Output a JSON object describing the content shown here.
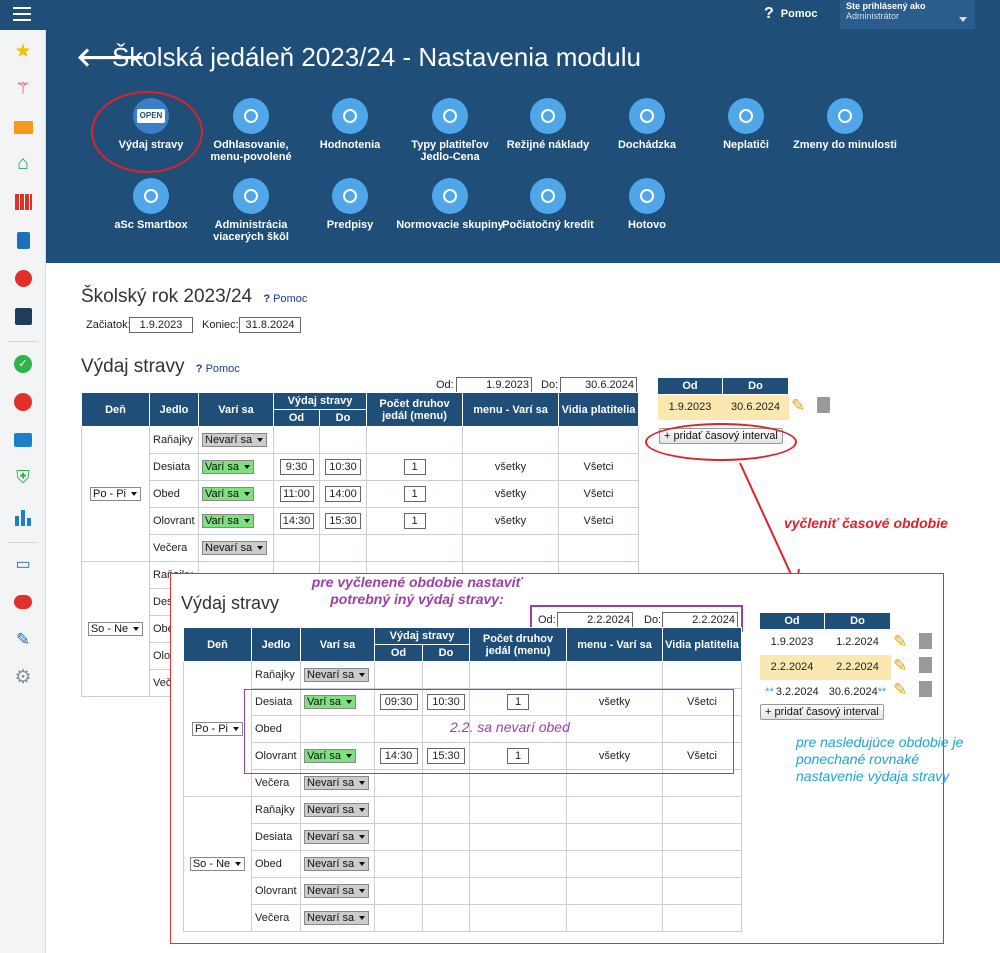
{
  "topbar": {
    "help_label": "Pomoc",
    "logged_as_label": "Ste prihlásený ako",
    "role_value": "Administrátor"
  },
  "header": {
    "title": "Školská jedáleň 2023/24 - Nastavenia modulu"
  },
  "tiles": [
    {
      "label": "Výdaj stravy",
      "icon": "open-sign-icon"
    },
    {
      "label": "Odhlasovanie, menu-povolené",
      "icon": "clock-icon"
    },
    {
      "label": "Hodnotenia",
      "icon": "star-icon"
    },
    {
      "label": "Typy platiteľov Jedlo-Cena",
      "icon": "payer-icon"
    },
    {
      "label": "Režijné náklady",
      "icon": "euro-plus-icon"
    },
    {
      "label": "Dochádzka",
      "icon": "walking-icon"
    },
    {
      "label": "Neplatiči",
      "icon": "money-bag-icon"
    },
    {
      "label": "Zmeny do minulosti",
      "icon": "alarm-icon"
    },
    {
      "label": "aSc Smartbox",
      "icon": "monitor-icon"
    },
    {
      "label": "Administrácia viacerých škôl",
      "icon": "hierarchy-icon"
    },
    {
      "label": "Predpisy",
      "icon": "handshake-icon"
    },
    {
      "label": "Normovacie skupiny",
      "icon": "groups-icon"
    },
    {
      "label": "Počiatočný kredit",
      "icon": "euro-arrow-icon"
    },
    {
      "label": "Hotovo",
      "icon": "check-icon"
    }
  ],
  "school_year": {
    "title": "Školský rok 2023/24",
    "help": "Pomoc",
    "start_label": "Začiatok:",
    "start_value": "1.9.2023",
    "end_label": "Koniec:",
    "end_value": "31.8.2024"
  },
  "section": {
    "title": "Výdaj stravy",
    "help": "Pomoc",
    "od_label": "Od:",
    "od_value": "1.9.2023",
    "do_label": "Do:",
    "do_value": "30.6.2024"
  },
  "columns": {
    "den": "Deň",
    "jedlo": "Jedlo",
    "vari_sa": "Varí sa",
    "vydaj": "Výdaj stravy",
    "od": "Od",
    "do": "Do",
    "pocet": "Počet druhov jedál (menu)",
    "menu": "menu - Varí sa",
    "vidia": "Vidia platitelia"
  },
  "main_rows": [
    {
      "meal": "Raňajky",
      "status": "Nevarí sa",
      "od": "",
      "do": "",
      "count": "",
      "menu": "",
      "payers": ""
    },
    {
      "meal": "Desiata",
      "status": "Varí sa",
      "od": "9:30",
      "do": "10:30",
      "count": "1",
      "menu": "všetky",
      "payers": "Všetci"
    },
    {
      "meal": "Obed",
      "status": "Varí sa",
      "od": "11:00",
      "do": "14:00",
      "count": "1",
      "menu": "všetky",
      "payers": "Všetci"
    },
    {
      "meal": "Olovrant",
      "status": "Varí sa",
      "od": "14:30",
      "do": "15:30",
      "count": "1",
      "menu": "všetky",
      "payers": "Všetci"
    },
    {
      "meal": "Večera",
      "status": "Nevarí sa",
      "od": "",
      "do": "",
      "count": "",
      "menu": "",
      "payers": ""
    }
  ],
  "main_days": {
    "weekday": "Po - Pi",
    "weekend": "So - Ne",
    "weekend_meals": [
      "Raňajky",
      "Desiata",
      "Obed",
      "Olovrant",
      "Večera"
    ]
  },
  "intervals": {
    "od_header": "Od",
    "do_header": "Do",
    "rows": [
      {
        "od": "1.9.2023",
        "do": "30.6.2024"
      }
    ],
    "add_button": "+ pridať časový interval"
  },
  "annotations": {
    "split_label": "vyčleniť časové obdobie",
    "set_label": "pre vyčlenené obdobie nastaviť potrebný iný výdaj stravy:",
    "no_lunch": "2.2. sa nevarí obed",
    "remaining": "pre nasledujúce obdobie je ponechané rovnaké nastavenie výdaja stravy"
  },
  "inset": {
    "title": "Výdaj stravy",
    "od_label": "Od:",
    "od_value": "2.2.2024",
    "do_label": "Do:",
    "do_value": "2.2.2024",
    "weekday_label": "Po - Pi",
    "weekend_label": "So - Ne",
    "rows": [
      {
        "meal": "Raňajky",
        "status": "Nevarí sa",
        "od": "",
        "do": "",
        "count": "",
        "menu": "",
        "payers": ""
      },
      {
        "meal": "Desiata",
        "status": "Varí sa",
        "od": "09:30",
        "do": "10:30",
        "count": "1",
        "menu": "všetky",
        "payers": "Všetci"
      },
      {
        "meal": "Obed",
        "status": "",
        "od": "",
        "do": "",
        "count": "",
        "menu": "",
        "payers": ""
      },
      {
        "meal": "Olovrant",
        "status": "Varí sa",
        "od": "14:30",
        "do": "15:30",
        "count": "1",
        "menu": "všetky",
        "payers": "Všetci"
      },
      {
        "meal": "Večera",
        "status": "Nevarí sa",
        "od": "",
        "do": "",
        "count": "",
        "menu": "",
        "payers": ""
      }
    ],
    "weekend_rows": [
      "Raňajky",
      "Desiata",
      "Obed",
      "Olovrant",
      "Večera"
    ],
    "weekend_status": "Nevarí sa",
    "intervals": [
      {
        "od": "1.9.2023",
        "do": "1.2.2024",
        "marker": ""
      },
      {
        "od": "2.2.2024",
        "do": "2.2.2024",
        "marker": ""
      },
      {
        "od": "3.2.2024",
        "do": "30.6.2024",
        "marker": "**"
      }
    ],
    "add_button": "+ pridať časový interval"
  },
  "colors": {
    "header_bg": "#1f4e79",
    "accent_red": "#e0202a",
    "annotation_purple": "#9b3fa6",
    "annotation_blue": "#1fa3d6"
  }
}
